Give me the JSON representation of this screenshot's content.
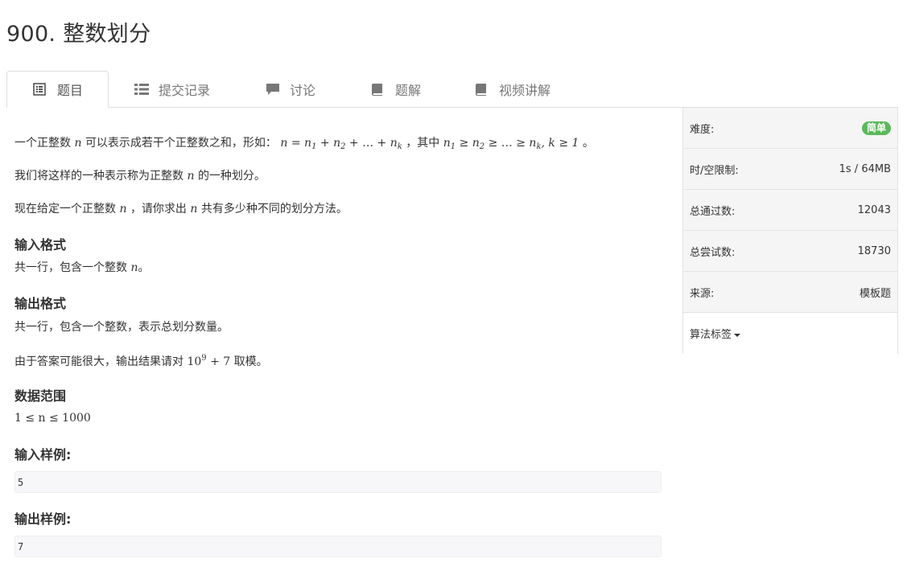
{
  "problem": {
    "title": "900. 整数划分"
  },
  "tabs": [
    {
      "label": "题目",
      "icon": "list-alt-icon"
    },
    {
      "label": "提交记录",
      "icon": "list-icon"
    },
    {
      "label": "讨论",
      "icon": "comment-icon"
    },
    {
      "label": "题解",
      "icon": "book-icon"
    },
    {
      "label": "视频讲解",
      "icon": "book-icon"
    }
  ],
  "sidebar": {
    "difficulty_label": "难度:",
    "difficulty_value": "简单",
    "difficulty_color": "#5cb85c",
    "limit_label": "时/空限制:",
    "limit_value": "1s / 64MB",
    "accepted_label": "总通过数:",
    "accepted_value": "12043",
    "attempts_label": "总尝试数:",
    "attempts_value": "18730",
    "source_label": "来源:",
    "source_value": "模板题",
    "tags_label": "算法标签"
  },
  "content": {
    "p1_a": "一个正整数",
    "p1_b": "可以表示成若干个正整数之和，形如：",
    "p1_c": "，其中",
    "p1_d": "。",
    "p2_a": "我们将这样的一种表示称为正整数",
    "p2_b": "的一种划分。",
    "p3_a": "现在给定一个正整数",
    "p3_b": "，请你求出",
    "p3_c": "共有多少种不同的划分方法。",
    "input_heading": "输入格式",
    "input_text_a": "共一行，包含一个整数",
    "input_text_b": "。",
    "output_heading": "输出格式",
    "output_text": "共一行，包含一个整数，表示总划分数量。",
    "mod_a": "由于答案可能很大，输出结果请对",
    "mod_b": "取模。",
    "range_heading": "数据范围",
    "sample_input_heading": "输入样例:",
    "sample_input": "5",
    "sample_output_heading": "输出样例:",
    "sample_output": "7"
  },
  "math": {
    "var_n": "n",
    "formula_lhs": "n = n",
    "formula_1": "1",
    "formula_plus_n": " + n",
    "formula_2": "2",
    "formula_dots": " + … + n",
    "formula_k": "k",
    "cond_n": "n",
    "cond_ge_n": " ≥ n",
    "cond_dots": " ≥ … ≥ n",
    "cond_tail": ", k ≥ 1",
    "mod_base": "10",
    "mod_exp": "9",
    "mod_tail": " + 7",
    "range": "1 ≤ n ≤ 1000"
  }
}
